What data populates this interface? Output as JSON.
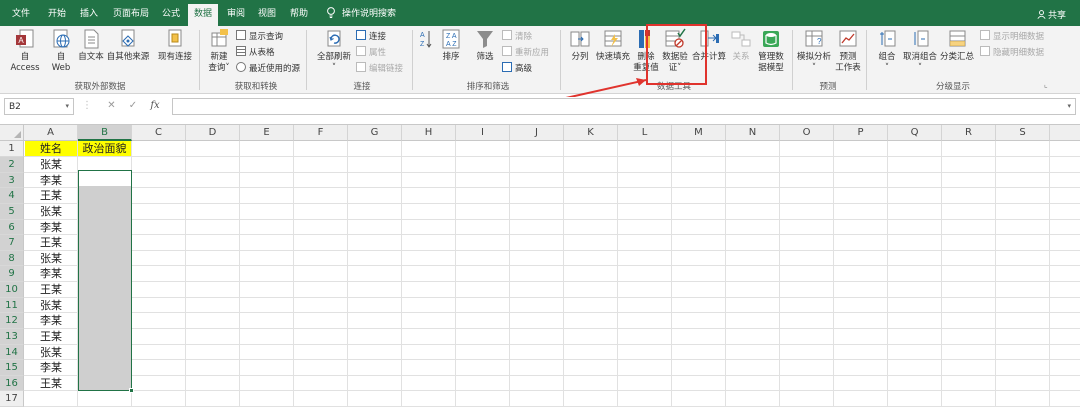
{
  "tabs": [
    "文件",
    "开始",
    "插入",
    "页面布局",
    "公式",
    "数据",
    "审阅",
    "视图",
    "帮助",
    "操作说明搜索"
  ],
  "active_tab": "数据",
  "share_label": "共享",
  "ribbon": {
    "get_external": {
      "group_label": "获取外部数据",
      "access": "自 Access",
      "web": "自\nWeb",
      "text": "自文本",
      "other": "自其他来源",
      "existing": "现有连接"
    },
    "get_transform": {
      "group_label": "获取和转换",
      "new_query": "新建\n查询",
      "show_query": "显示查询",
      "from_table": "从表格",
      "recent": "最近使用的源"
    },
    "connections": {
      "group_label": "连接",
      "refresh_all": "全部刷新",
      "connections": "连接",
      "properties": "属性",
      "edit_links": "编辑链接"
    },
    "sort_filter": {
      "group_label": "排序和筛选",
      "sort": "排序",
      "filter": "筛选",
      "clear": "清除",
      "reapply": "重新应用",
      "advanced": "高级"
    },
    "data_tools": {
      "group_label": "数据工具",
      "text_to_columns": "分列",
      "flash_fill": "快速填充",
      "remove_dup": "删除\n重复值",
      "validation": "数据验\n证",
      "consolidate": "合并计算",
      "relationships": "关系",
      "manage_model": "管理数\n据模型"
    },
    "forecast": {
      "group_label": "预测",
      "what_if": "模拟分析",
      "forecast_sheet": "预测\n工作表"
    },
    "outline": {
      "group_label": "分级显示",
      "group": "组合",
      "ungroup": "取消组合",
      "subtotal": "分类汇总",
      "show_detail": "显示明细数据",
      "hide_detail": "隐藏明细数据"
    }
  },
  "formula_bar": {
    "name_box": "B2",
    "fx": "fx",
    "cancel": "✕",
    "confirm": "✓",
    "content": ""
  },
  "columns": [
    "A",
    "B",
    "C",
    "D",
    "E",
    "F",
    "G",
    "H",
    "I",
    "J",
    "K",
    "L",
    "M",
    "N",
    "O",
    "P",
    "Q",
    "R",
    "S"
  ],
  "rows": [
    "1",
    "2",
    "3",
    "4",
    "5",
    "6",
    "7",
    "8",
    "9",
    "10",
    "11",
    "12",
    "13",
    "14",
    "15",
    "16",
    "17"
  ],
  "cells": {
    "a1": "姓名",
    "b1": "政治面貌",
    "names": [
      "张某",
      "李某",
      "王某",
      "张某",
      "李某",
      "王某",
      "张某",
      "李某",
      "王某",
      "张某",
      "李某",
      "王某",
      "张某",
      "李某",
      "王某"
    ]
  },
  "colors": {
    "brand": "#217346",
    "header_fill": "#ffff00",
    "highlight_box": "#e0332d"
  }
}
